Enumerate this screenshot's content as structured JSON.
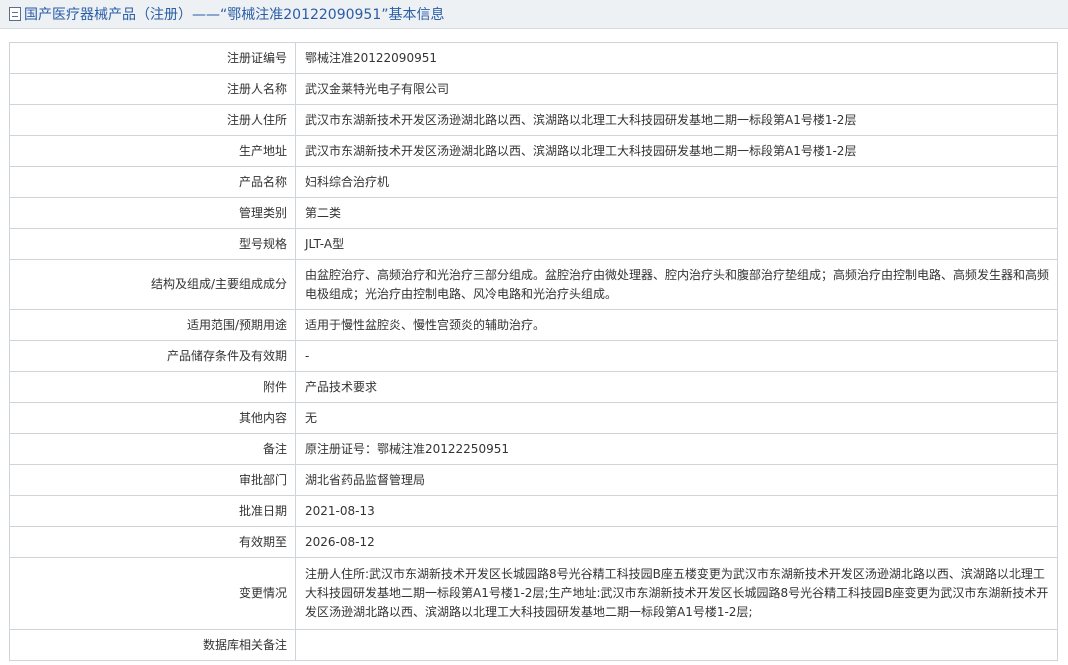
{
  "header": {
    "title": "国产医疗器械产品（注册）——“鄂械注准20122090951”基本信息",
    "icon": "document-icon"
  },
  "rows": [
    {
      "label": "注册证编号",
      "value": "鄂械注准20122090951"
    },
    {
      "label": "注册人名称",
      "value": "武汉金莱特光电子有限公司"
    },
    {
      "label": "注册人住所",
      "value": "武汉市东湖新技术开发区汤逊湖北路以西、滨湖路以北理工大科技园研发基地二期一标段第A1号楼1-2层"
    },
    {
      "label": "生产地址",
      "value": "武汉市东湖新技术开发区汤逊湖北路以西、滨湖路以北理工大科技园研发基地二期一标段第A1号楼1-2层"
    },
    {
      "label": "产品名称",
      "value": "妇科综合治疗机"
    },
    {
      "label": "管理类别",
      "value": "第二类"
    },
    {
      "label": "型号规格",
      "value": "JLT-A型"
    },
    {
      "label": "结构及组成/主要组成成分",
      "value": "由盆腔治疗、高频治疗和光治疗三部分组成。盆腔治疗由微处理器、腔内治疗头和腹部治疗垫组成；高频治疗由控制电路、高频发生器和高频电极组成；光治疗由控制电路、风冷电路和光治疗头组成。"
    },
    {
      "label": "适用范围/预期用途",
      "value": "适用于慢性盆腔炎、慢性宫颈炎的辅助治疗。"
    },
    {
      "label": "产品储存条件及有效期",
      "value": "-"
    },
    {
      "label": "附件",
      "value": "产品技术要求"
    },
    {
      "label": "其他内容",
      "value": "无"
    },
    {
      "label": "备注",
      "value": "原注册证号：鄂械注准20122250951"
    },
    {
      "label": "审批部门",
      "value": "湖北省药品监督管理局"
    },
    {
      "label": "批准日期",
      "value": "2021-08-13"
    },
    {
      "label": "有效期至",
      "value": "2026-08-12"
    },
    {
      "label": "变更情况",
      "value": "注册人住所:武汉市东湖新技术开发区长城园路8号光谷精工科技园B座五楼变更为武汉市东湖新技术开发区汤逊湖北路以西、滨湖路以北理工大科技园研发基地二期一标段第A1号楼1-2层;生产地址:武汉市东湖新技术开发区长城园路8号光谷精工科技园B座变更为武汉市东湖新技术开发区汤逊湖北路以西、滨湖路以北理工大科技园研发基地二期一标段第A1号楼1-2层;"
    },
    {
      "label": "数据库相关备注",
      "value": ""
    }
  ]
}
